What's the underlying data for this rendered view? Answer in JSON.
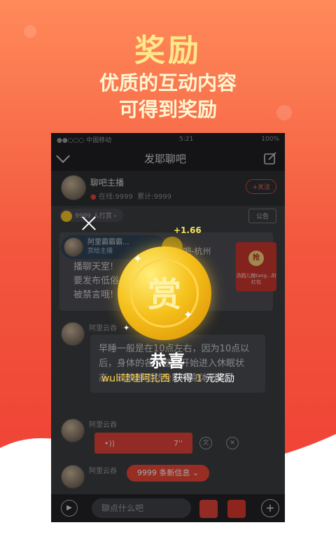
{
  "hero": {
    "title": "奖励",
    "subtitle_line1": "优质的互动内容",
    "subtitle_line2": "可得到奖励"
  },
  "status_bar": {
    "carrier": "●●○○○ 中国移动",
    "time": "5:21",
    "battery": "100%"
  },
  "nav": {
    "title": "发耶聊吧"
  },
  "host": {
    "name": "聊吧主播",
    "online": "在线:9999",
    "total": "累计:9999",
    "follow_label": "+关注"
  },
  "reward_bar": {
    "count_label": "9999 人打赏",
    "notice_label": "公告"
  },
  "announcement": {
    "gifter_name": "阿里霸霸霸...",
    "gifter_action": "赏给主播",
    "text_tail": "聊吧-杭州",
    "line1": "播聊天室!",
    "line2": "要发布低俗",
    "line2_tail": "环境",
    "line3": "被禁言哦!"
  },
  "red_packet": {
    "button": "抢",
    "text": "汤圆儿糖tang...的红包"
  },
  "messages": [
    {
      "speaker": "阿里云吞",
      "text": "早睡一般是在10点左右，因为10点以后，身体的各个器官开始进入休眠状态，过晚睡觉然会影响身体机能"
    },
    {
      "speaker": "阿里云吞",
      "voice_duration": "7''"
    },
    {
      "speaker": "阿里云吞"
    }
  ],
  "voice": {
    "wave": "•))"
  },
  "actions": {
    "translate": "文",
    "close": "✕"
  },
  "new_messages": "9999 条新信息 ⌄",
  "input": {
    "placeholder": "聊点什么吧"
  },
  "reward_popup": {
    "float_value": "+1.66",
    "coin_char": "赏",
    "congrats": "恭喜",
    "username": "wuli哇哇阿扎西",
    "got": "获得",
    "amount": "1",
    "unit": "元奖励"
  },
  "colors": {
    "accent": "#ea4636",
    "gold": "#ffd24a"
  }
}
